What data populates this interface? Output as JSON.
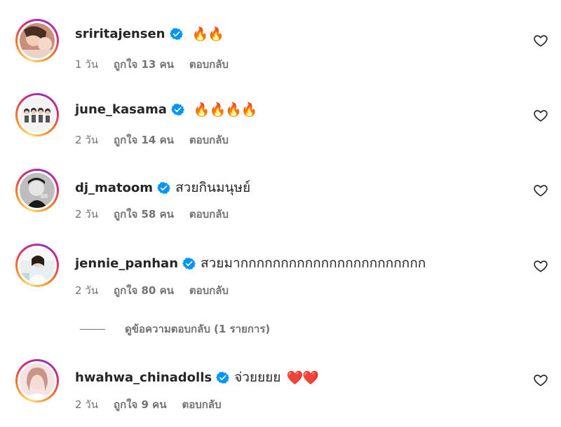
{
  "comments": [
    {
      "username": "sriritajensen",
      "verified": true,
      "text": "",
      "emoji": "🔥🔥",
      "time": "1 วัน",
      "likes": "ถูกใจ 13 คน",
      "reply": "ตอบกลับ",
      "avatar_color": "#d9a48c"
    },
    {
      "username": "june_kasama",
      "verified": true,
      "text": "",
      "emoji": "🔥🔥🔥🔥",
      "time": "2 วัน",
      "likes": "ถูกใจ 14 คน",
      "reply": "ตอบกลับ",
      "avatar_color": "#e8e8e8"
    },
    {
      "username": "dj_matoom",
      "verified": true,
      "text": "สวยกินมนุษย์",
      "emoji": "",
      "time": "2 วัน",
      "likes": "ถูกใจ 58 คน",
      "reply": "ตอบกลับ",
      "avatar_color": "#cfcfcf"
    },
    {
      "username": "jennie_panhan",
      "verified": true,
      "text": "สวยมากกกกกกกกกกกกกกกกกกกกกกก",
      "emoji": "",
      "time": "2 วัน",
      "likes": "ถูกใจ 80 คน",
      "reply": "ตอบกลับ",
      "avatar_color": "#d7dde3"
    },
    {
      "username": "hwahwa_chinadolls",
      "verified": true,
      "text": "จ่วยยยย",
      "emoji": "❤️❤️",
      "time": "2 วัน",
      "likes": "ถูกใจ 9 คน",
      "reply": "ตอบกลับ",
      "avatar_color": "#f0d6d4"
    }
  ],
  "view_replies": "ดูข้อความตอบกลับ (1 รายการ)",
  "colors": {
    "verified": "#0095f6",
    "secondary_text": "#737373",
    "primary_text": "#262626"
  },
  "icons": {
    "like": "heart-outline-icon",
    "verified": "verified-badge-icon"
  }
}
